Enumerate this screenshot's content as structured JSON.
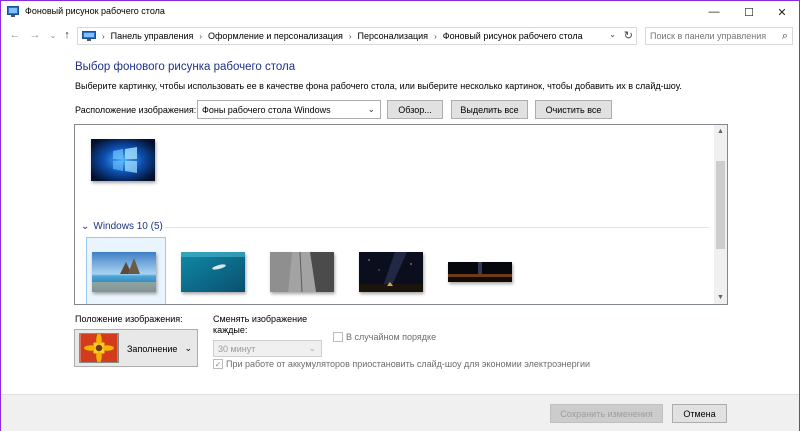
{
  "window": {
    "title": "Фоновый рисунок рабочего стола",
    "controls": {
      "minimize": "—",
      "maximize": "☐",
      "close": "✕"
    }
  },
  "nav": {
    "back": "←",
    "forward": "→",
    "up": "↑"
  },
  "address": {
    "crumbs": [
      "Панель управления",
      "Оформление и персонализация",
      "Персонализация",
      "Фоновый рисунок рабочего стола"
    ],
    "separator": "›",
    "dropdown": "⌄",
    "refresh": "↻"
  },
  "search": {
    "placeholder": "Поиск в панели управления",
    "icon": "⌕"
  },
  "main": {
    "heading": "Выбор фонового рисунка рабочего стола",
    "subtitle": "Выберите картинку, чтобы использовать ее в качестве фона рабочего стола, или выберите несколько картинок, чтобы добавить их в слайд-шоу.",
    "location_label": "Расположение изображения:",
    "location_value": "Фоны рабочего стола Windows",
    "browse_button": "Обзор...",
    "select_all_button": "Выделить все",
    "clear_all_button": "Очистить все"
  },
  "gallery": {
    "group_name": "Windows 10 (5)",
    "group_toggle": "⌄",
    "scroll_up": "▲",
    "scroll_down": "▼",
    "images": [
      "windows-hero",
      "beach-rocks",
      "underwater-swimmer",
      "rocky-canyon",
      "night-sky-tent",
      "horizon-night"
    ]
  },
  "options": {
    "position_label": "Положение изображения:",
    "position_value": "Заполнение",
    "interval_label": "Сменять изображение каждые:",
    "interval_value": "30 минут",
    "shuffle_label": "В случайном порядке",
    "shuffle_checked": false,
    "battery_label": "При работе от аккумуляторов приостановить слайд-шоу для экономии электроэнергии",
    "battery_checked": true
  },
  "footer": {
    "save_button": "Сохранить изменения",
    "cancel_button": "Отмена"
  },
  "colors": {
    "heading": "#1e3287",
    "window_border": "#8a2be2",
    "selection": "#99c9f0"
  }
}
